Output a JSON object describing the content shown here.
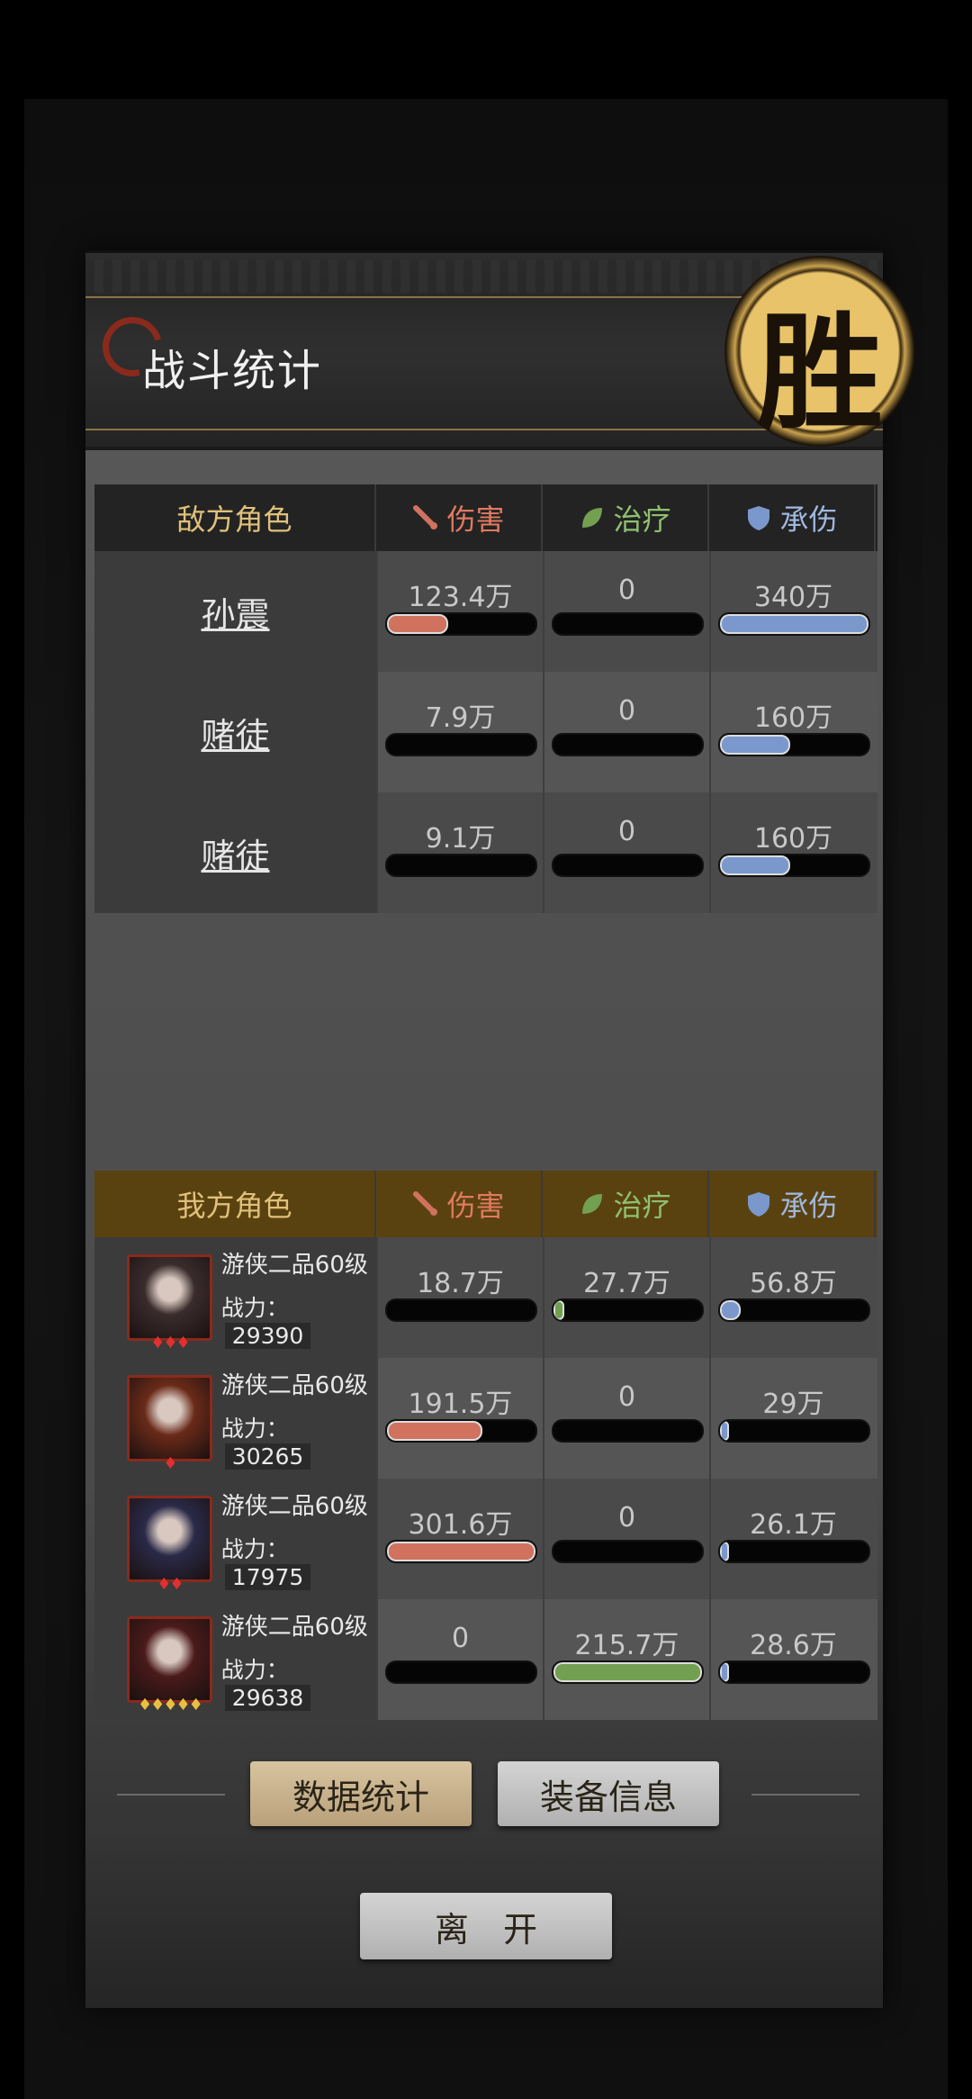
{
  "header": {
    "title": "战斗统计",
    "seal": "胜"
  },
  "columns": {
    "dmg": "伤害",
    "heal": "治疗",
    "tank": "承伤"
  },
  "enemy": {
    "header": "敌方角色",
    "rows": [
      {
        "name": "孙震",
        "dmg": "123.4万",
        "heal": "0",
        "tank": "340万",
        "dmg_frac": 0.41,
        "heal_frac": 0,
        "tank_frac": 1.0
      },
      {
        "name": "赌徒",
        "dmg": "7.9万",
        "heal": "0",
        "tank": "160万",
        "dmg_frac": 0,
        "heal_frac": 0,
        "tank_frac": 0.47
      },
      {
        "name": "赌徒",
        "dmg": "9.1万",
        "heal": "0",
        "tank": "160万",
        "dmg_frac": 0,
        "heal_frac": 0,
        "tank_frac": 0.47
      }
    ]
  },
  "ally": {
    "header": "我方角色",
    "rows": [
      {
        "name": "游侠二品60级",
        "power_label": "战力：",
        "power": "29390",
        "stars": "♦♦♦",
        "star_color": "red",
        "dmg": "18.7万",
        "heal": "27.7万",
        "tank": "56.8万",
        "dmg_frac": 0,
        "heal_frac": 0.07,
        "tank_frac": 0.14
      },
      {
        "name": "游侠二品60级",
        "power_label": "战力：",
        "power": "30265",
        "stars": "♦",
        "star_color": "red",
        "dmg": "191.5万",
        "heal": "0",
        "tank": "29万",
        "dmg_frac": 0.64,
        "heal_frac": 0,
        "tank_frac": 0.02
      },
      {
        "name": "游侠二品60级",
        "power_label": "战力：",
        "power": "17975",
        "stars": "♦♦",
        "star_color": "red",
        "dmg": "301.6万",
        "heal": "0",
        "tank": "26.1万",
        "dmg_frac": 1.0,
        "heal_frac": 0,
        "tank_frac": 0.02
      },
      {
        "name": "游侠二品60级",
        "power_label": "战力：",
        "power": "29638",
        "stars": "♦♦♦♦♦",
        "star_color": "gold",
        "dmg": "0",
        "heal": "215.7万",
        "tank": "28.6万",
        "dmg_frac": 0,
        "heal_frac": 1.0,
        "tank_frac": 0.02
      }
    ]
  },
  "buttons": {
    "stats": "数据统计",
    "equip": "装备信息",
    "leave": "离　开"
  },
  "colors": {
    "dmg": "#d0725e",
    "heal": "#72a050",
    "tank": "#7a98cc"
  }
}
